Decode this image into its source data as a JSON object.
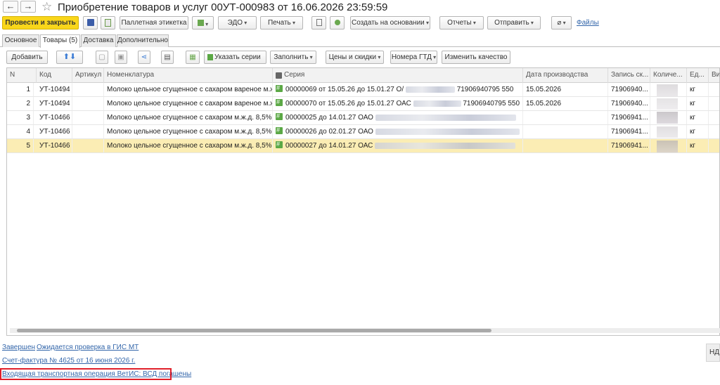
{
  "window": {
    "title": "Приобретение товаров и услуг 00УТ-000983 от 16.06.2026 23:59:59",
    "back": "←",
    "forward": "→",
    "star": "☆"
  },
  "toolbar": {
    "post_close": "Провести и закрыть",
    "save_icon": "💾",
    "post_icon": "📄",
    "pallet_label": "Паллетная этикетка",
    "edo": "ЭДО",
    "print": "Печать",
    "create_based": "Создать на основании",
    "reports": "Отчеты",
    "send": "Отправить",
    "files": "Файлы"
  },
  "tabs": [
    {
      "label": "Основное"
    },
    {
      "label": "Товары (5)"
    },
    {
      "label": "Доставка"
    },
    {
      "label": "Дополнительно"
    }
  ],
  "items_toolbar": {
    "add": "Добавить",
    "specify_series": "Указать серии",
    "fill": "Заполнить",
    "prices": "Цены и скидки",
    "gtd": "Номера ГТД",
    "change_quality": "Изменить качество"
  },
  "grid": {
    "columns": [
      "N",
      "Код",
      "Артикул",
      "Номенклатура",
      "Серия",
      "Дата производства",
      "Запись ск...",
      "Количе...",
      "Ед...",
      "Ви"
    ],
    "rows": [
      {
        "n": "1",
        "code": "УТ-10494",
        "article": "",
        "name": "Молоко цельное сгущенное с сахаром  вареное м.ж...",
        "series": "00000069 от 15.05.26 до 15.01.27 О/",
        "series_tail": "71906940795 550",
        "date": "15.05.2026",
        "record": "71906940...",
        "unit": "кг"
      },
      {
        "n": "2",
        "code": "УТ-10494",
        "article": "",
        "name": "Молоко цельное сгущенное с сахаром  вареное м.ж...",
        "series": "00000070 от 15.05.26 до 15.01.27 ОАС",
        "series_tail": "71906940795 550",
        "date": "15.05.2026",
        "record": "71906940...",
        "unit": "кг"
      },
      {
        "n": "3",
        "code": "УТ-10466",
        "article": "",
        "name": "Молоко цельное сгущенное с сахаром м.ж.д. 8,5% ...",
        "series": "00000025 до 14.01.27 ОАО",
        "series_tail": "",
        "date": "",
        "record": "71906941...",
        "unit": "кг"
      },
      {
        "n": "4",
        "code": "УТ-10466",
        "article": "",
        "name": "Молоко цельное сгущенное с сахаром м.ж.д. 8,5% ...",
        "series": "00000026 до 02.01.27 ОАО",
        "series_tail": "",
        "date": "",
        "record": "71906941...",
        "unit": "кг"
      },
      {
        "n": "5",
        "code": "УТ-10466",
        "article": "",
        "name": "Молоко цельное сгущенное с сахаром м.ж.д. 8,5% ...",
        "series": "00000027 до 14.01.27 ОАС",
        "series_tail": "",
        "date": "",
        "record": "71906941...",
        "unit": "кг"
      }
    ],
    "selected_row": 5
  },
  "footer": {
    "status_done": "Завершен",
    "status_check": "Ожидается проверка в ГИС МТ",
    "invoice": "Счет-фактура № 4625 от 16 июня 2026 г.",
    "vetis": "Входящая транспортная операция ВетИС: ВСД погашены",
    "nds": "НДС"
  },
  "colors": {
    "primary_button": "#f9d61a",
    "selected_row": "#fbedb4",
    "link": "#3366aa",
    "highlight_box": "#e0202a",
    "series_icon": "#5ba845"
  }
}
